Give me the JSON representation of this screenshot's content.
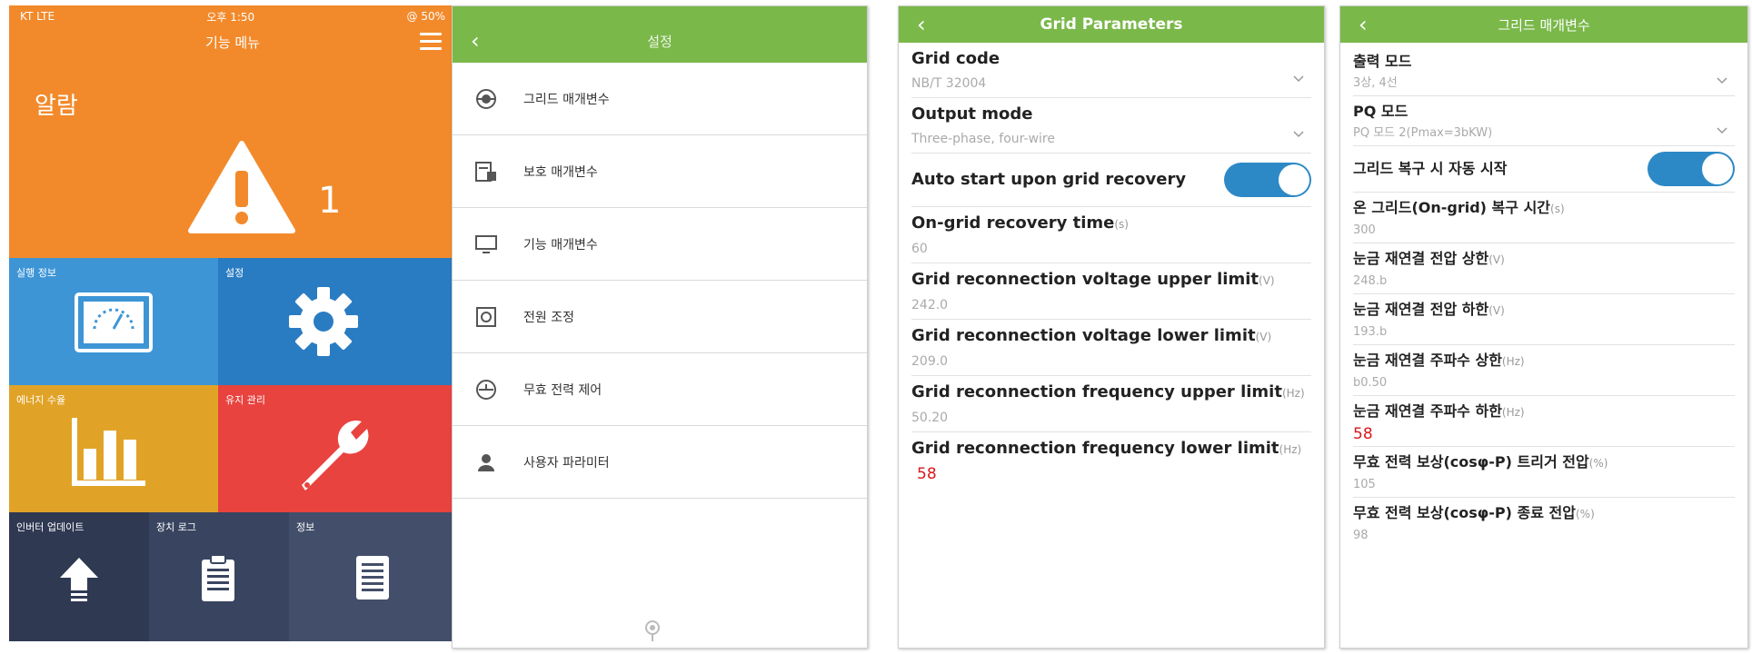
{
  "screen1": {
    "status": {
      "carrier": "KT LTE",
      "time": "오후 1:50",
      "battery": "@ 50%"
    },
    "nav_title": "기능 메뉴",
    "alarm": {
      "title": "알람",
      "count": "1"
    },
    "tiles": {
      "run_info": "실행 정보",
      "settings": "설정",
      "energy_yield": "에너지 수율",
      "maintenance": "유지 관리",
      "inverter_update": "인버터 업데이트",
      "device_log": "장치 로그",
      "info": "정보"
    },
    "colors": {
      "orange": "#f28a2b",
      "blue": "#3d95d6",
      "dark_blue": "#2a7cc2",
      "yellow": "#e1a327",
      "red": "#e8433f",
      "navy": "#2f3952"
    }
  },
  "screen2": {
    "title": "설정",
    "items": [
      {
        "label": "그리드 매개변수",
        "icon": "grid-icon"
      },
      {
        "label": "보호 매개변수",
        "icon": "protection-icon"
      },
      {
        "label": "기능 매개변수",
        "icon": "monitor-icon"
      },
      {
        "label": "전원 조정",
        "icon": "power-icon"
      },
      {
        "label": "무효 전력 제어",
        "icon": "reactive-power-icon"
      },
      {
        "label": "사용자 파라미터",
        "icon": "user-icon"
      }
    ],
    "accent": "#7ab84a"
  },
  "screen3": {
    "title": "Grid Parameters",
    "grid_code": {
      "label": "Grid code",
      "value": "NB/T 32004"
    },
    "output_mode": {
      "label": "Output mode",
      "value": "Three-phase, four-wire"
    },
    "auto_start": {
      "label": "Auto start upon grid recovery",
      "on": true
    },
    "recovery_time": {
      "label": "On-grid recovery time",
      "unit": "(s)",
      "value": "60"
    },
    "volt_upper": {
      "label": "Grid reconnection voltage upper limit",
      "unit": "(V)",
      "value": "242.0"
    },
    "volt_lower": {
      "label": "Grid reconnection voltage lower limit",
      "unit": "(V)",
      "value": "209.0"
    },
    "freq_upper": {
      "label": "Grid reconnection frequency upper limit",
      "unit": "(Hz)",
      "value": "50.20"
    },
    "freq_lower": {
      "label": "Grid reconnection frequency lower limit",
      "unit": "(Hz)",
      "value": "58"
    }
  },
  "screen4": {
    "title": "그리드 매개변수",
    "output_mode": {
      "label": "출력 모드",
      "value": "3상, 4선"
    },
    "pq_mode": {
      "label": "PQ 모드",
      "value": "PQ 모드 2(Pmax=3bKW)"
    },
    "auto_start": {
      "label": "그리드 복구 시 자동 시작",
      "on": true
    },
    "recovery_time": {
      "label": "온 그리드(On-grid) 복구 시간",
      "unit": "(s)",
      "value": "300"
    },
    "volt_upper": {
      "label": "눈금 재연결 전압 상한",
      "unit": "(V)",
      "value": "248.b"
    },
    "volt_lower": {
      "label": "눈금 재연결 전압 하한",
      "unit": "(V)",
      "value": "193.b"
    },
    "freq_upper": {
      "label": "눈금 재연결 주파수 상한",
      "unit": "(Hz)",
      "value": "b0.50"
    },
    "freq_lower": {
      "label": "눈금 재연결 주파수 하한",
      "unit": "(Hz)",
      "value": "58"
    },
    "cos_trigger": {
      "label": "무효 전력 보상(cosφ-P) 트리거 전압",
      "unit": "(%)",
      "value": "105"
    },
    "cos_end": {
      "label": "무효 전력 보상(cosφ-P) 종료 전압",
      "unit": "(%)",
      "value": "98"
    }
  }
}
